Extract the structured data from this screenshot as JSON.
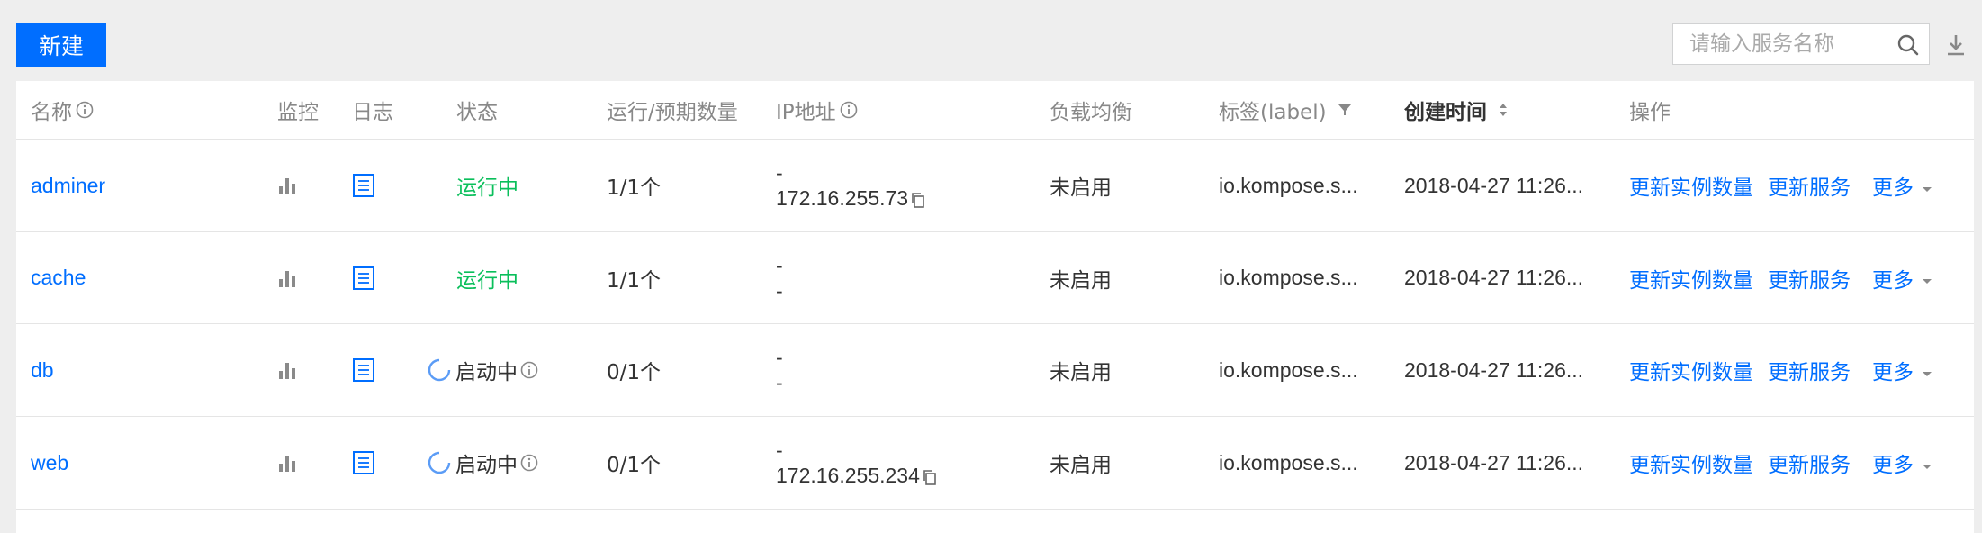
{
  "toolbar": {
    "new_label": "新建"
  },
  "search": {
    "placeholder": "请输入服务名称",
    "value": ""
  },
  "colors": {
    "accent": "#006eff",
    "running": "#0abf5b"
  },
  "icons": {
    "search": "search-icon",
    "download": "download-icon",
    "info": "info-icon",
    "filter": "filter-icon",
    "sort": "sort-icon",
    "monitor": "bar-chart-icon",
    "log": "document-icon",
    "loading": "spinner-icon",
    "copy": "copy-icon",
    "more": "caret-down-icon"
  },
  "table": {
    "headers": {
      "name": "名称",
      "monitor": "监控",
      "log": "日志",
      "status": "状态",
      "count": "运行/预期数量",
      "ip": "IP地址",
      "lb": "负载均衡",
      "label": "标签(label)",
      "created": "创建时间",
      "ops": "操作"
    },
    "rows": [
      {
        "name": "adminer",
        "status": "运行中",
        "count": "1/1个",
        "ip1": "-",
        "ip2": "172.16.255.73",
        "lb": "未启用",
        "label": "io.kompose.s...",
        "created": "2018-04-27 11:26...",
        "op1": "更新实例数量",
        "op2": "更新服务",
        "op3": "更多"
      },
      {
        "name": "cache",
        "status": "运行中",
        "count": "1/1个",
        "ip1": "-",
        "ip2": "-",
        "lb": "未启用",
        "label": "io.kompose.s...",
        "created": "2018-04-27 11:26...",
        "op1": "更新实例数量",
        "op2": "更新服务",
        "op3": "更多"
      },
      {
        "name": "db",
        "status": "启动中",
        "count": "0/1个",
        "ip1": "-",
        "ip2": "-",
        "lb": "未启用",
        "label": "io.kompose.s...",
        "created": "2018-04-27 11:26...",
        "op1": "更新实例数量",
        "op2": "更新服务",
        "op3": "更多"
      },
      {
        "name": "web",
        "status": "启动中",
        "count": "0/1个",
        "ip1": "-",
        "ip2": "172.16.255.234",
        "lb": "未启用",
        "label": "io.kompose.s...",
        "created": "2018-04-27 11:26...",
        "op1": "更新实例数量",
        "op2": "更新服务",
        "op3": "更多"
      }
    ]
  }
}
